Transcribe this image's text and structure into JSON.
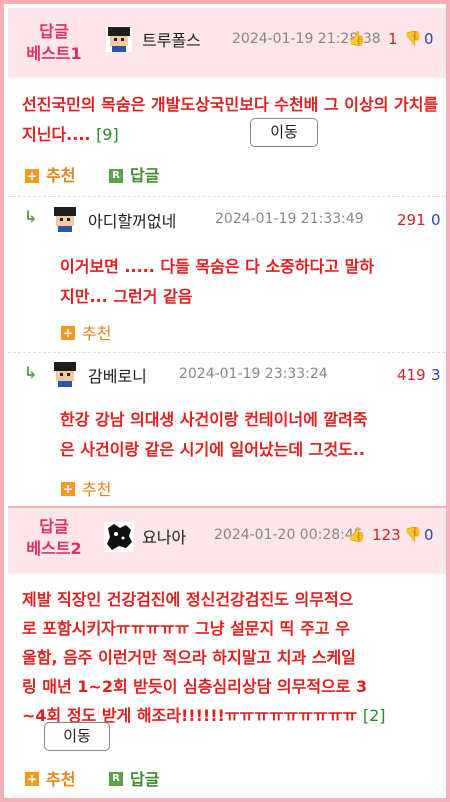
{
  "best1": {
    "badge_line1": "답글",
    "badge_line2": "베스트1",
    "author": "트루폴스",
    "date": "2024-01-19 21:28:38",
    "upvotes": "1",
    "downvotes": "0",
    "text": "선진국민의 목숨은 개발도상국민보다 수천배 그 이상의 가치를 지닌다....",
    "comment_count": "[9]",
    "move_label": "이동",
    "recommend_label": "추천",
    "reply_label": "답글",
    "replies": [
      {
        "author": "아디할꺼없네",
        "date": "2024-01-19 21:33:49",
        "upvotes": "291",
        "downvotes": "0",
        "text_line1": "이거보면 ..... 다들 목숨은 다 소중하다고 말하",
        "text_line2": "지만... 그런거 같음",
        "recommend_label": "추천"
      },
      {
        "author": "감베로니",
        "date": "2024-01-19 23:33:24",
        "upvotes": "419",
        "downvotes": "3",
        "text_line1": "한강 강남 의대생 사건이랑 컨테이너에 깔려죽",
        "text_line2": "은 사건이랑 같은 시기에 일어났는데 그것도..",
        "recommend_label": "추천"
      }
    ]
  },
  "best2": {
    "badge_line1": "답글",
    "badge_line2": "베스트2",
    "author": "요나아",
    "date": "2024-01-20 00:28:45",
    "upvotes": "123",
    "downvotes": "0",
    "text_line1": "제발 직장인 건강검진에 정신건강검진도 의무적으",
    "text_line2": "로 포함시키자ㅠㅠㅠㅠㅠ 그냥 설문지 띡 주고 우",
    "text_line3": "울함, 음주 이런거만 적으라 하지말고 치과 스케일",
    "text_line4": "링 매년 1~2회 받듯이 심층심리상담 의무적으로 3",
    "text_line5": "~4회 정도 받게 해조라!!!!!!ㅠㅠㅠㅠㅠㅠㅠㅠㅠ",
    "comment_count": "[2]",
    "move_label": "이동",
    "recommend_label": "추천",
    "reply_label": "답글"
  },
  "icons": {
    "thumb_up": "👍",
    "thumb_down": "👎",
    "plus": "+",
    "reply_badge": "R",
    "reply_arrow": "↳"
  },
  "colors": {
    "border": "#f4b0b7",
    "header_bg": "#fde6e9",
    "badge": "#e02e68",
    "text_red": "#e02020",
    "upvote": "#d52323",
    "downvote": "#2244bb",
    "recommend": "#e0841b",
    "reply": "#3e8c2d"
  }
}
